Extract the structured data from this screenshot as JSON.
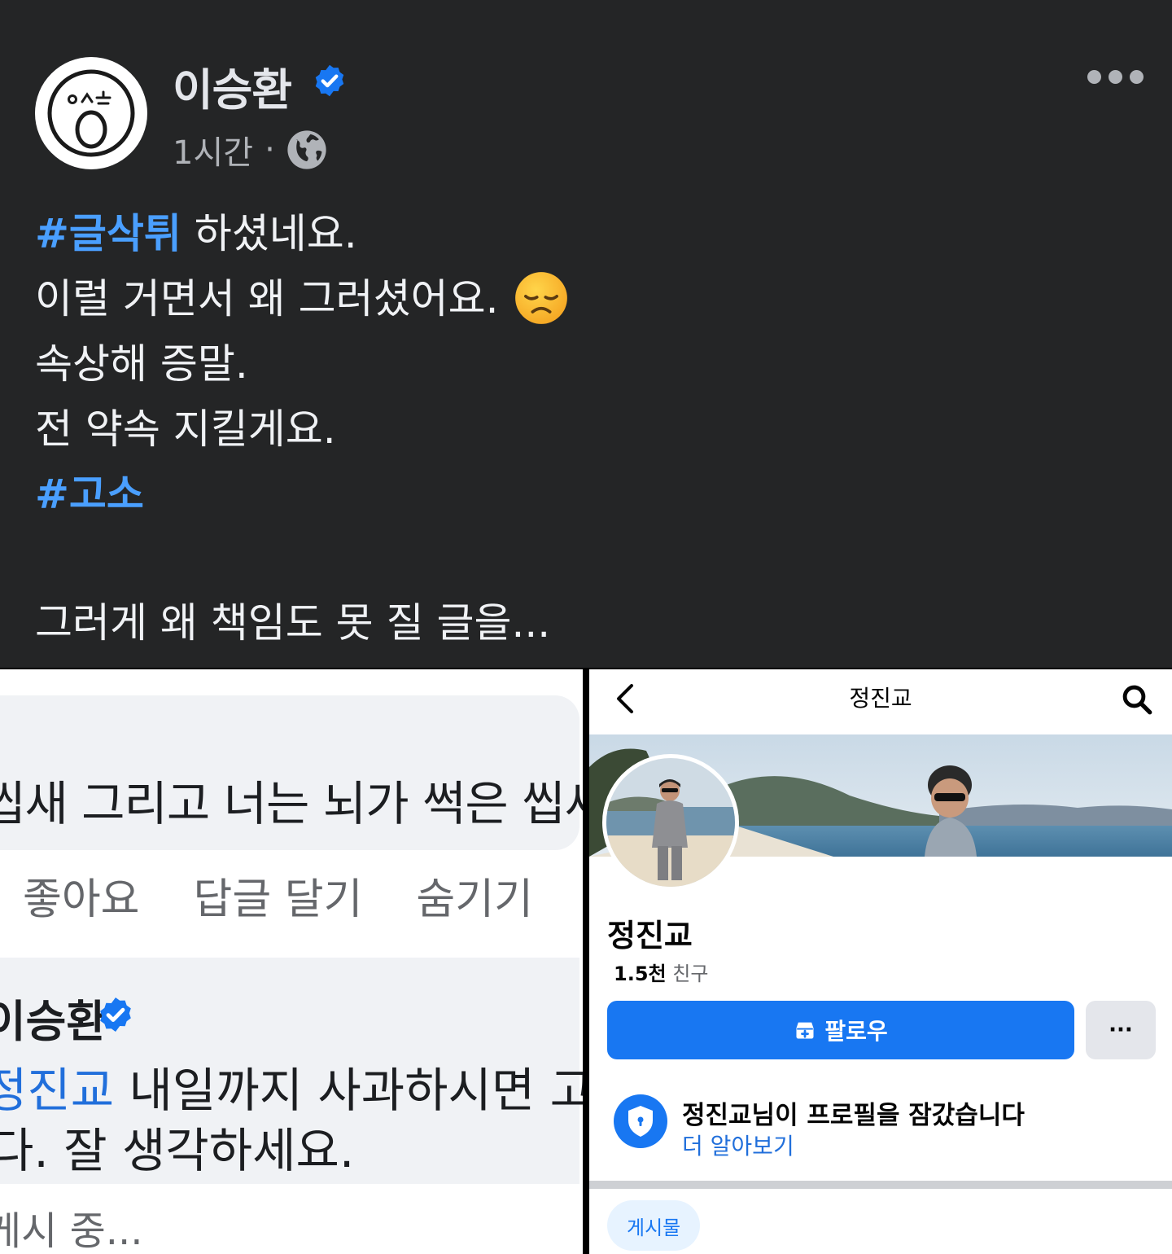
{
  "post": {
    "author": "이승환",
    "time": "1시간",
    "separator": "·",
    "body_lines": [
      {
        "hashtag": "#글삭튀",
        "text": " 하셨네요."
      },
      {
        "hashtag": "",
        "text": "이럴 거면서 왜 그러셨어요."
      },
      {
        "hashtag": "",
        "text": "속상해 증말."
      },
      {
        "hashtag": "",
        "text": "전 약속 지킬게요."
      },
      {
        "hashtag": "#고소",
        "text": ""
      }
    ],
    "closing_line": "그러게 왜 책임도 못 질 글을...",
    "emoji": "disappointed-face",
    "colors": {
      "background": "#242526",
      "hashtag": "#4a9fff",
      "verified": "#1877f2"
    }
  },
  "comment_crop": {
    "comment1_text": "씹새 그리고 너는 뇌가 썩은 씹새!",
    "actions": [
      "좋아요",
      "답글 달기",
      "숨기기"
    ],
    "comment2_author": "이승환",
    "comment2_mention": "정진교",
    "comment2_line1": " 내일까지 사과하시면 고소",
    "comment2_line2": "다. 잘 생각하세요.",
    "posting_status": "게시 중..."
  },
  "profile_crop": {
    "header_title": "정진교",
    "name": "정진교",
    "friends_count": "1.5천",
    "friends_label": "친구",
    "follow_label": "팔로우",
    "more_label": "···",
    "locked_message": "정진교님이 프로필을 잠갔습니다",
    "learn_more": "더 알아보기",
    "tab_posts": "게시물",
    "colors": {
      "primary": "#1877f2",
      "link": "#216fdb"
    }
  }
}
